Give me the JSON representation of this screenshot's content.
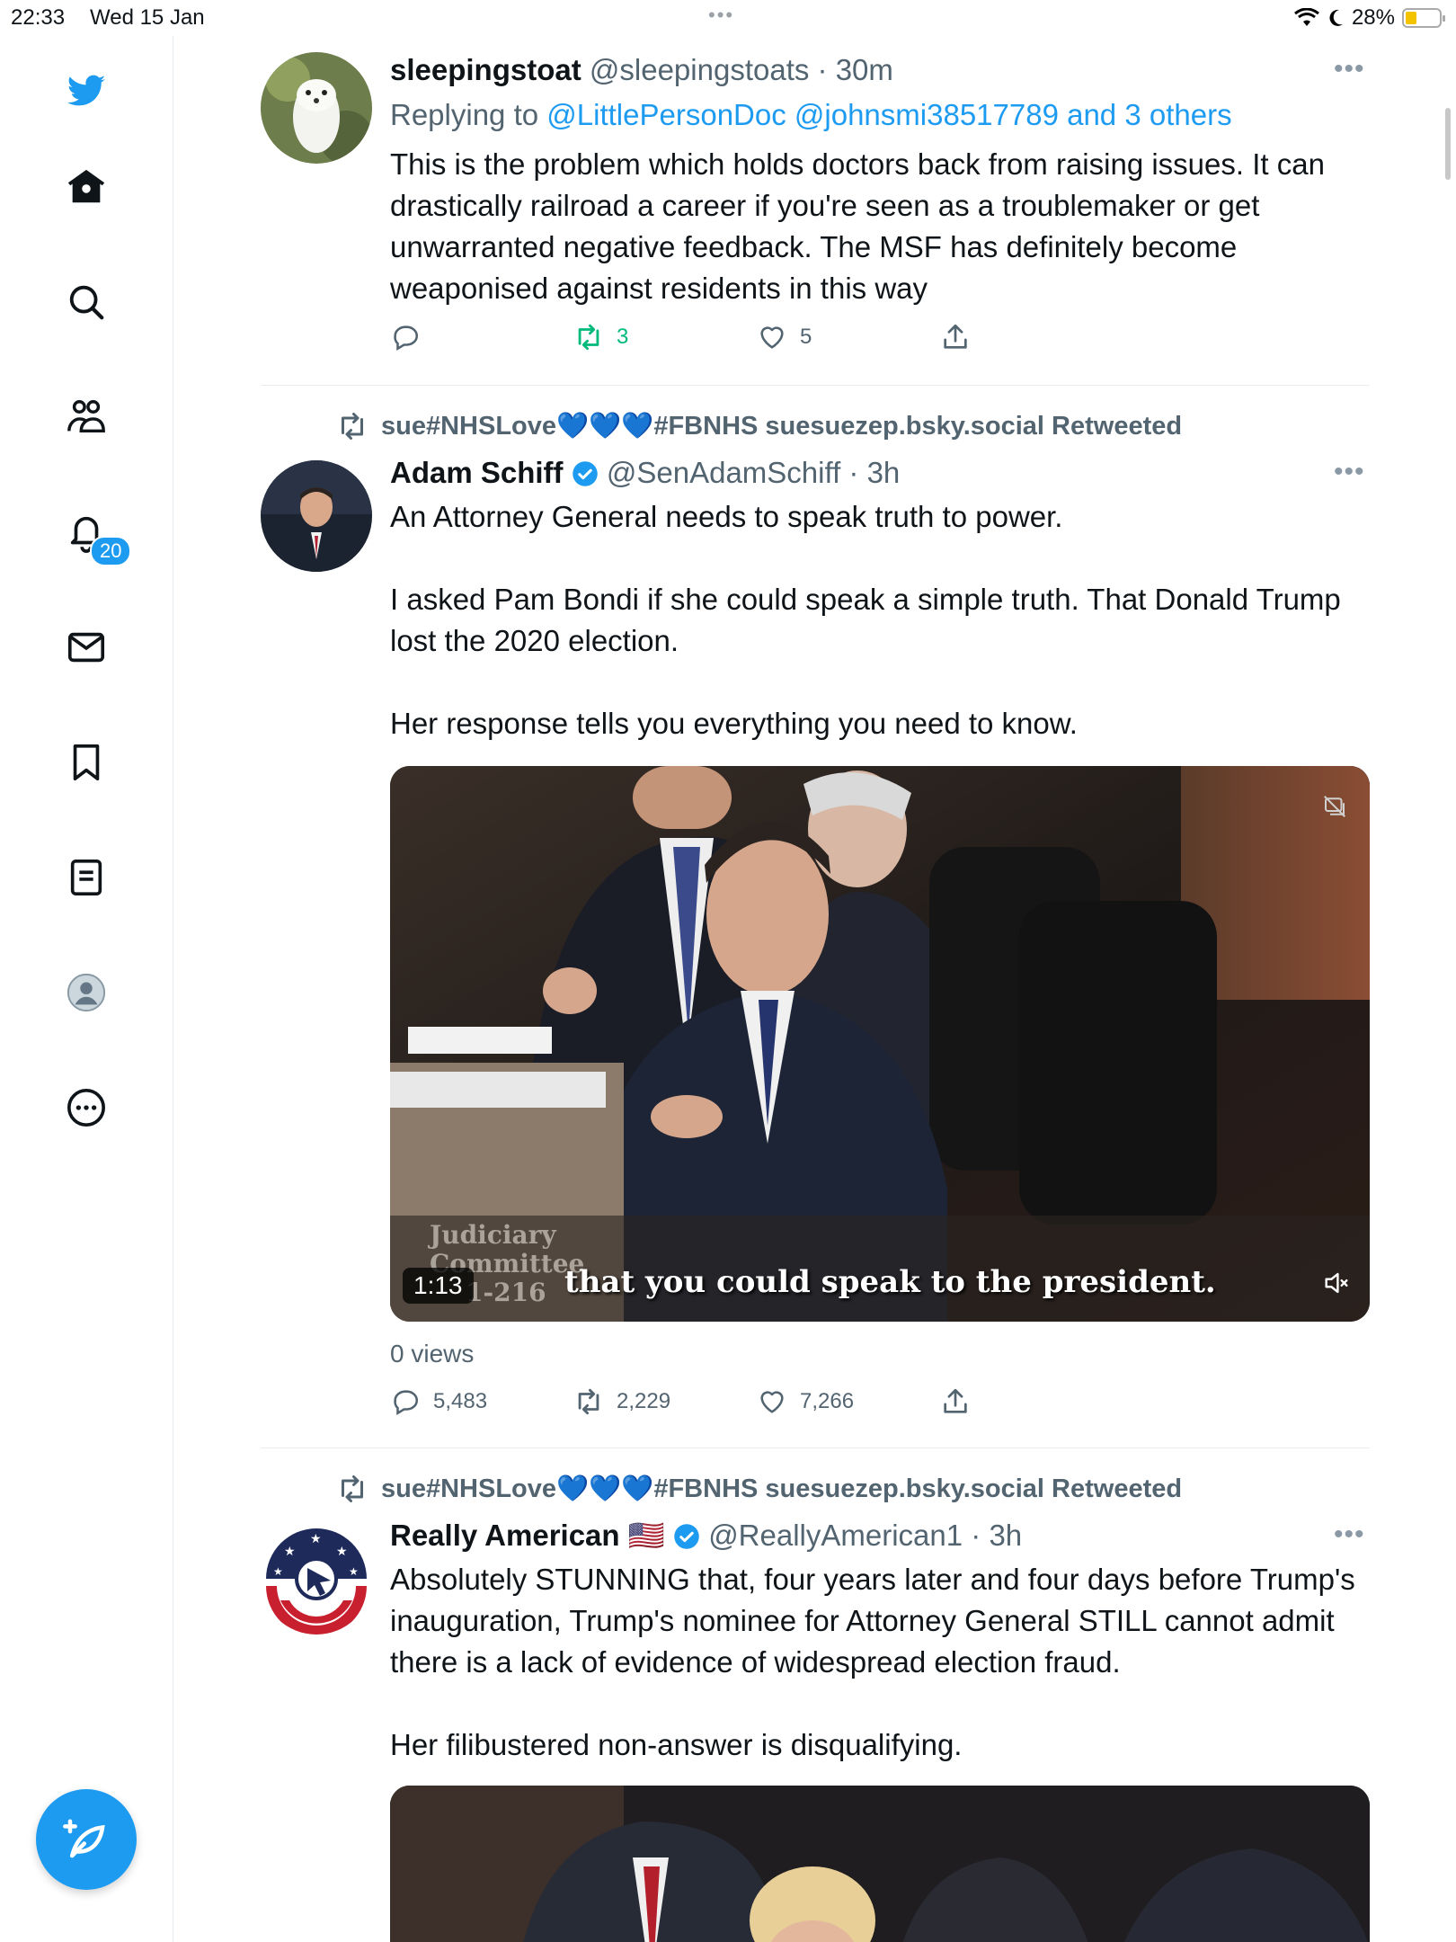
{
  "status_bar": {
    "time": "22:33",
    "date": "Wed 15 Jan",
    "battery": "28%"
  },
  "sidebar": {
    "notifications_badge": "20"
  },
  "tweets": [
    {
      "display_name": "sleepingstoat",
      "handle": "@sleepingstoats",
      "time": "· 30m",
      "replying_prefix": "Replying to",
      "replying_to": "@LittlePersonDoc @johnsmi38517789 and 3 others",
      "text": "This is the problem which holds doctors back from raising issues. It can drastically railroad a career if you're seen as a troublemaker or get unwarranted negative feedback. The MSF has definitely become weaponised against residents in this way",
      "retweets": "3",
      "likes": "5"
    },
    {
      "retweeted_by": "sue#NHSLove💙💙💙#FBNHS suesuezep.bsky.social Retweeted",
      "display_name": "Adam Schiff",
      "handle": "@SenAdamSchiff",
      "time": "· 3h",
      "text_lines": [
        "An Attorney General needs to speak truth to power.",
        "I asked Pam Bondi if she could speak a simple truth. That Donald Trump lost the 2020 election.",
        "Her response tells you everything you need to know."
      ],
      "video": {
        "duration": "1:13",
        "caption": "that you could speak to the president.",
        "watermark_line1": "Judiciary",
        "watermark_line2": "Committee",
        "watermark_line3": "1-216"
      },
      "views": "0 views",
      "replies": "5,483",
      "retweets": "2,229",
      "likes": "7,266"
    },
    {
      "retweeted_by": "sue#NHSLove💙💙💙#FBNHS suesuezep.bsky.social Retweeted",
      "display_name": "Really American",
      "flag": "🇺🇸",
      "handle": "@ReallyAmerican1",
      "time": "· 3h",
      "text_lines": [
        "Absolutely STUNNING that, four years later and four days before Trump's inauguration, Trump's nominee for Attorney General STILL cannot admit there is a lack of evidence of widespread election fraud.",
        "Her filibustered non-answer is disqualifying."
      ]
    }
  ],
  "colors": {
    "accent": "#1d9bf0",
    "retweet_active": "#00ba7c",
    "muted": "#536471"
  }
}
